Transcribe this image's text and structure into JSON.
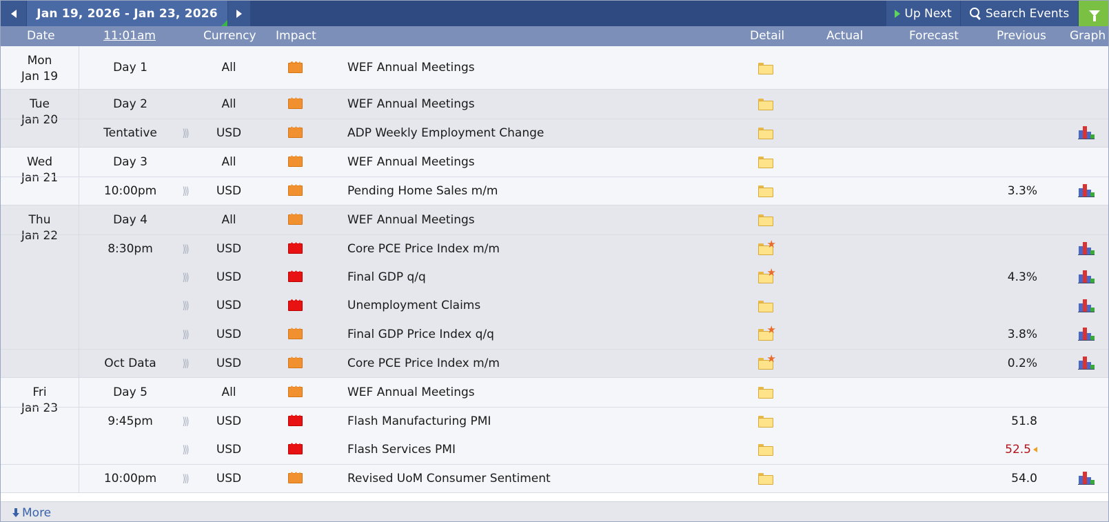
{
  "toolbar": {
    "date_range": "Jan 19, 2026 - Jan 23, 2026",
    "up_next_label": "Up Next",
    "search_label": "Search Events"
  },
  "columns": {
    "date": "Date",
    "time": "11:01am",
    "currency": "Currency",
    "impact": "Impact",
    "detail": "Detail",
    "actual": "Actual",
    "forecast": "Forecast",
    "previous": "Previous",
    "graph": "Graph"
  },
  "colors": {
    "toolbar": "#2f4a80",
    "header": "#7b8fb9",
    "impact_orange": "#f0902f",
    "impact_red": "#e81212",
    "filter_green": "#7ac043",
    "revised_value": "#b3141c"
  },
  "days": [
    {
      "day": "Mon",
      "date": "Jan 19",
      "events": [
        {
          "time": "Day 1",
          "currency": "All",
          "impact": "orange",
          "title": "WEF Annual Meetings",
          "detail_icon": "folder-icon",
          "previous": "",
          "graph": false,
          "sound": false
        }
      ]
    },
    {
      "day": "Tue",
      "date": "Jan 20",
      "events": [
        {
          "time": "Day 2",
          "currency": "All",
          "impact": "orange",
          "title": "WEF Annual Meetings",
          "detail_icon": "folder-icon",
          "previous": "",
          "graph": false,
          "sound": false
        },
        {
          "time": "Tentative",
          "currency": "USD",
          "impact": "orange",
          "title": "ADP Weekly Employment Change",
          "detail_icon": "folder-icon",
          "previous": "",
          "graph": true,
          "sound": true
        }
      ]
    },
    {
      "day": "Wed",
      "date": "Jan 21",
      "events": [
        {
          "time": "Day 3",
          "currency": "All",
          "impact": "orange",
          "title": "WEF Annual Meetings",
          "detail_icon": "folder-icon",
          "previous": "",
          "graph": false,
          "sound": false
        },
        {
          "time": "10:00pm",
          "currency": "USD",
          "impact": "orange",
          "title": "Pending Home Sales m/m",
          "detail_icon": "folder-icon",
          "previous": "3.3%",
          "graph": true,
          "sound": true
        }
      ]
    },
    {
      "day": "Thu",
      "date": "Jan 22",
      "events": [
        {
          "time": "Day 4",
          "currency": "All",
          "impact": "orange",
          "title": "WEF Annual Meetings",
          "detail_icon": "folder-icon",
          "previous": "",
          "graph": false,
          "sound": false
        },
        {
          "time": "8:30pm",
          "currency": "USD",
          "impact": "red",
          "title": "Core PCE Price Index m/m",
          "detail_icon": "folder-star-icon",
          "previous": "",
          "graph": true,
          "sound": true
        },
        {
          "time": "",
          "currency": "USD",
          "impact": "red",
          "title": "Final GDP q/q",
          "detail_icon": "folder-star-icon",
          "previous": "4.3%",
          "graph": true,
          "sound": true
        },
        {
          "time": "",
          "currency": "USD",
          "impact": "red",
          "title": "Unemployment Claims",
          "detail_icon": "folder-icon",
          "previous": "",
          "graph": true,
          "sound": true
        },
        {
          "time": "",
          "currency": "USD",
          "impact": "orange",
          "title": "Final GDP Price Index q/q",
          "detail_icon": "folder-star-icon",
          "previous": "3.8%",
          "graph": true,
          "sound": true
        },
        {
          "time": "Oct Data",
          "currency": "USD",
          "impact": "orange",
          "title": "Core PCE Price Index m/m",
          "detail_icon": "folder-star-icon",
          "previous": "0.2%",
          "graph": true,
          "sound": true
        }
      ]
    },
    {
      "day": "Fri",
      "date": "Jan 23",
      "events": [
        {
          "time": "Day 5",
          "currency": "All",
          "impact": "orange",
          "title": "WEF Annual Meetings",
          "detail_icon": "folder-icon",
          "previous": "",
          "graph": false,
          "sound": false
        },
        {
          "time": "9:45pm",
          "currency": "USD",
          "impact": "red",
          "title": "Flash Manufacturing PMI",
          "detail_icon": "folder-icon",
          "previous": "51.8",
          "graph": false,
          "sound": true
        },
        {
          "time": "",
          "currency": "USD",
          "impact": "red",
          "title": "Flash Services PMI",
          "detail_icon": "folder-icon",
          "previous": "52.5",
          "previous_revised": true,
          "graph": false,
          "sound": true
        },
        {
          "time": "10:00pm",
          "currency": "USD",
          "impact": "orange",
          "title": "Revised UoM Consumer Sentiment",
          "detail_icon": "folder-icon",
          "previous": "54.0",
          "graph": true,
          "sound": true
        }
      ]
    }
  ],
  "footer": {
    "more_label": "More"
  }
}
